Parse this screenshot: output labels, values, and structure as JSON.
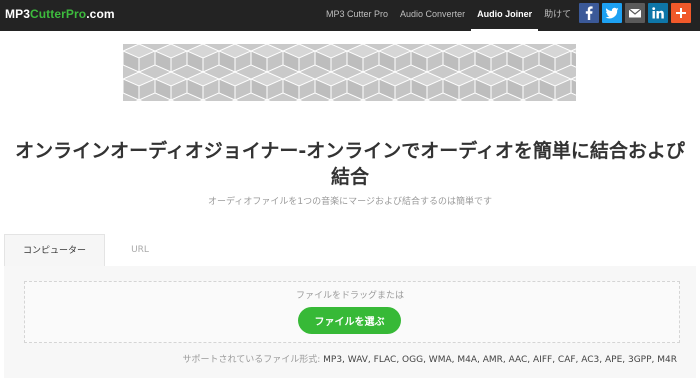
{
  "logo": {
    "part1": "MP3",
    "part2": "CutterPro",
    "part3": ".com"
  },
  "nav": {
    "items": [
      {
        "label": "MP3 Cutter Pro"
      },
      {
        "label": "Audio Converter"
      },
      {
        "label": "Audio Joiner",
        "active": true
      },
      {
        "label": "助けて"
      }
    ]
  },
  "social": [
    {
      "name": "facebook-icon",
      "color": "#3b5998",
      "glyph": "f"
    },
    {
      "name": "twitter-icon",
      "color": "#1da1f2",
      "glyph": "t"
    },
    {
      "name": "email-icon",
      "color": "#5a5a5a",
      "glyph": "✉"
    },
    {
      "name": "linkedin-icon",
      "color": "#0e76a8",
      "glyph": "in"
    },
    {
      "name": "share-plus-icon",
      "color": "#f1592a",
      "glyph": "+"
    }
  ],
  "main": {
    "title": "オンラインオーディオジョイナー-オンラインでオーディオを簡単に結合およぴ結合",
    "subtitle": "オーディオファイルを1つの音楽にマージおよび結合するのは簡単です"
  },
  "tabs": [
    {
      "label": "コンピューター",
      "active": true
    },
    {
      "label": "URL",
      "active": false
    }
  ],
  "upload": {
    "drop_text": "ファイルをドラッグまたは",
    "button_label": "ファイルを選ぶ",
    "formats_label": "サポートされているファイル形式:",
    "formats_value": "MP3, WAV, FLAC, OGG, WMA, M4A, AMR, AAC, AIFF, CAF, AC3, APE, 3GPP, M4R"
  },
  "colors": {
    "navbar": "#232323",
    "brand_green": "#3dbb3d",
    "button_green": "#37b937"
  }
}
